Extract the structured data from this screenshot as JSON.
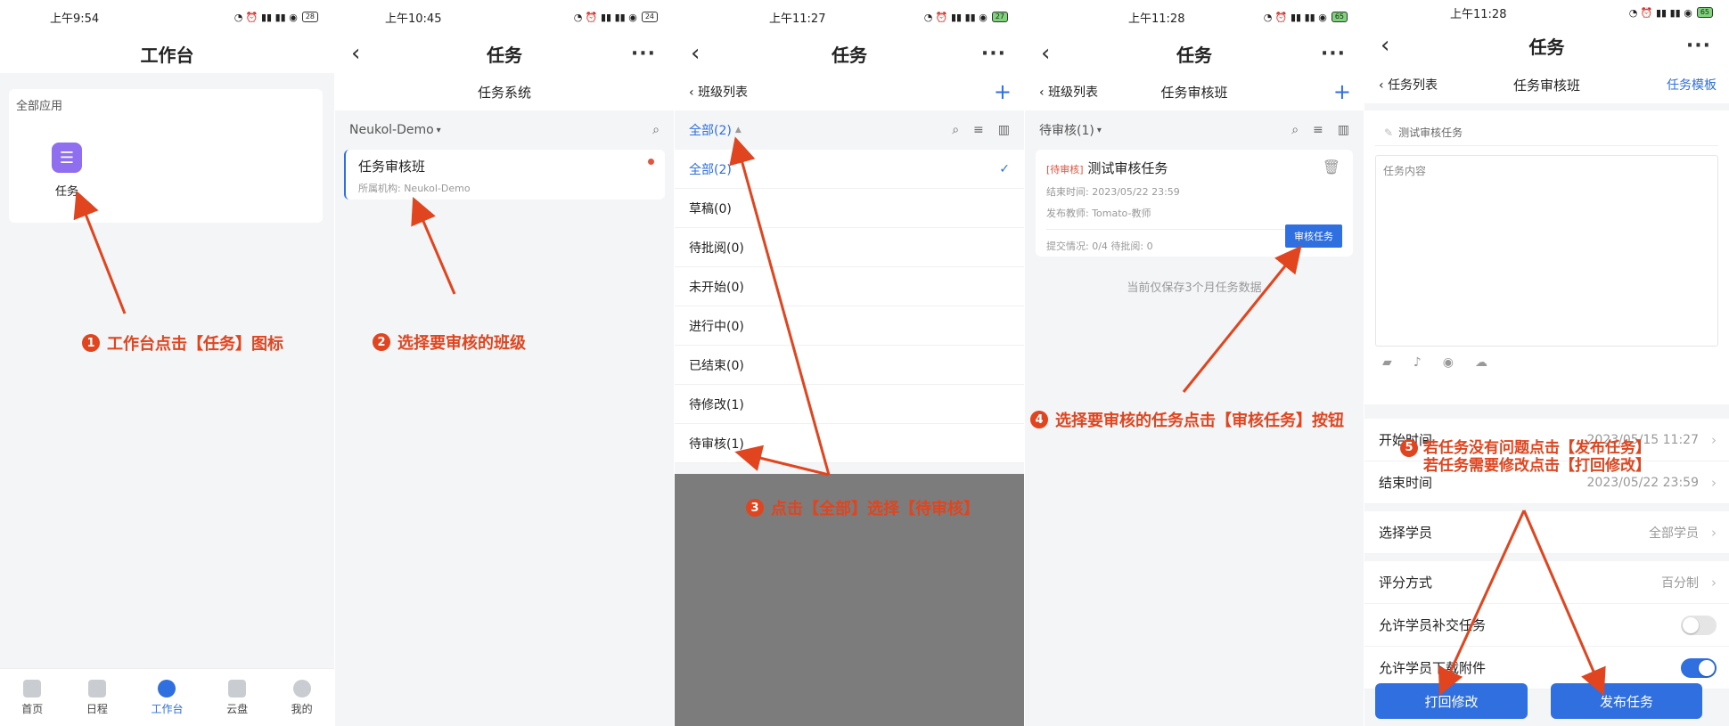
{
  "p1": {
    "time": "上午9:54",
    "battery": "28",
    "title": "工作台",
    "section": "全部应用",
    "app_label": "任务",
    "tabs": [
      "首页",
      "日程",
      "工作台",
      "云盘",
      "我的"
    ],
    "annot": "工作台点击【任务】图标",
    "num": "1"
  },
  "p2": {
    "time": "上午10:45",
    "battery": "24",
    "title": "任务",
    "subtitle": "任务系统",
    "org_filter": "Neukol-Demo",
    "class_name": "任务审核班",
    "class_org": "所属机构: Neukol-Demo",
    "annot": "选择要审核的班级",
    "num": "2"
  },
  "p3": {
    "time": "上午11:27",
    "battery": "27",
    "title": "任务",
    "back_label": "班级列表",
    "filter": "全部(2)",
    "options": [
      "全部(2)",
      "草稿(0)",
      "待批阅(0)",
      "未开始(0)",
      "进行中(0)",
      "已结束(0)",
      "待修改(1)",
      "待审核(1)"
    ],
    "annot": "点击【全部】选择【待审核】",
    "num": "3"
  },
  "p4": {
    "time": "上午11:28",
    "battery": "65",
    "title": "任务",
    "back_label": "班级列表",
    "subtitle": "任务审核班",
    "filter": "待审核(1)",
    "tag": "[待审核]",
    "task_title": "测试审核任务",
    "end_time": "结束时间: 2023/05/22 23:59",
    "teacher": "发布教师: Tomato-教师",
    "submit": "提交情况: 0/4 待批阅: 0",
    "review_btn": "审核任务",
    "note": "当前仅保存3个月任务数据",
    "annot": "选择要审核的任务点击【审核任务】按钮",
    "num": "4"
  },
  "p5": {
    "time": "上午11:28",
    "battery": "65",
    "title": "任务",
    "back_label": "任务列表",
    "subtitle": "任务审核班",
    "template": "任务模板",
    "task_name": "测试审核任务",
    "content_placeholder": "任务内容",
    "start_label": "开始时间",
    "start_val": "2023/05/15 11:27",
    "end_label": "结束时间",
    "end_val": "2023/05/22 23:59",
    "students_label": "选择学员",
    "students_val": "全部学员",
    "grading_label": "评分方式",
    "grading_val": "百分制",
    "allow_late": "允许学员补交任务",
    "allow_download": "允许学员下载附件",
    "btn_reject": "打回修改",
    "btn_publish": "发布任务",
    "annot1": "若任务没有问题点击【发布任务】",
    "annot2": "若任务需要修改点击【打回修改】",
    "num": "5"
  },
  "colors": {
    "accent": "#2f6fe0",
    "annotation": "#e0451f",
    "app_icon": "#8f6ef0"
  }
}
